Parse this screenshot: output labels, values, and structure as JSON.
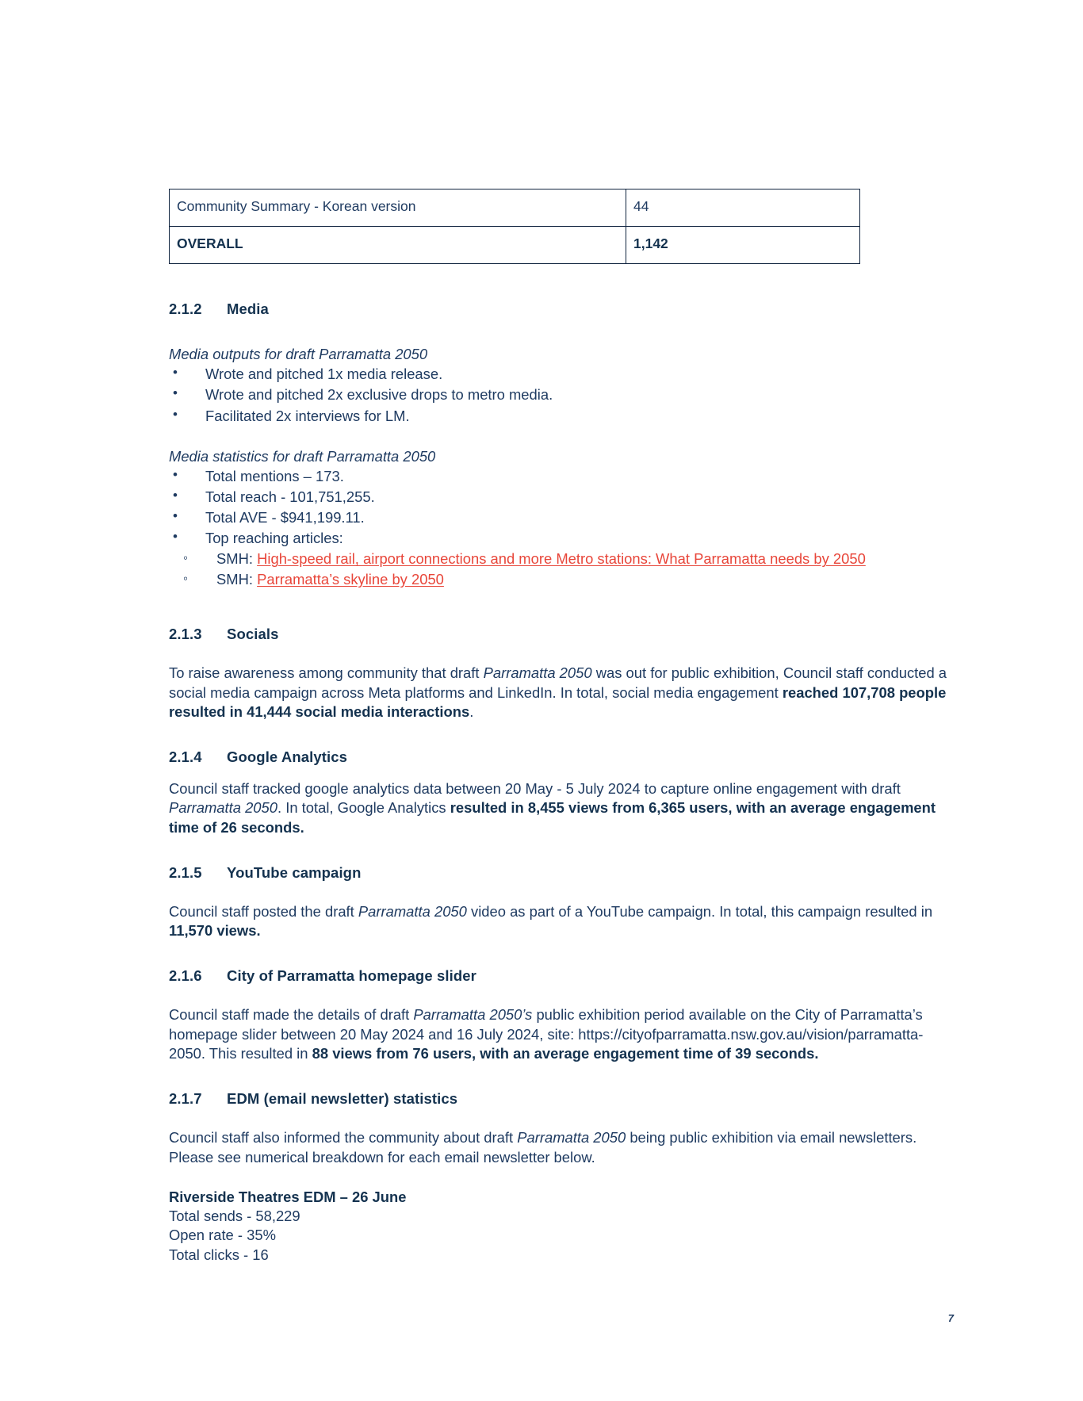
{
  "document": {
    "page_number": "7"
  },
  "table": {
    "rows": [
      {
        "label": "Community Summary - Korean version",
        "value": "44"
      },
      {
        "label": "OVERALL",
        "value": "1,142"
      }
    ]
  },
  "sections": {
    "media": {
      "number": "2.1.2",
      "title": "Media",
      "outputs_heading": "Media outputs for draft Parramatta 2050",
      "outputs": [
        "Wrote and pitched 1x media release.",
        "Wrote and pitched 2x exclusive drops to metro media.",
        "Facilitated 2x interviews for LM."
      ],
      "stats_heading": "Media statistics for draft Parramatta 2050",
      "stats": [
        "Total mentions – 173.",
        "Total reach - 101,751,255.",
        "Total AVE - $941,199.11.",
        "Top reaching articles:"
      ],
      "articles": [
        {
          "source": "SMH:",
          "link_text": "High-speed rail, airport connections and more Metro stations: What Parramatta needs by 2050"
        },
        {
          "source": "SMH:",
          "link_text": "Parramatta’s skyline by 2050"
        }
      ]
    },
    "socials": {
      "number": "2.1.3",
      "title": "Socials",
      "para_1": "To raise awareness among community that draft ",
      "para_italic_1": "Parramatta 2050",
      "para_2": " was out for public exhibition, Council staff conducted a social media campaign across Meta platforms and LinkedIn. In total, social media engagement ",
      "para_bold": "reached 107,708 people resulted in 41,444 social media interactions",
      "para_3": "."
    },
    "google_analytics": {
      "number": "2.1.4",
      "title": "Google Analytics",
      "para_1": "Council staff tracked google analytics data between 20 May - 5 July 2024 to capture online engagement with draft ",
      "para_italic_1": "Parramatta 2050",
      "para_2": ". In total, Google Analytics ",
      "para_bold": "resulted in 8,455 views from 6,365 users, with an average engagement time of 26 seconds."
    },
    "youtube": {
      "number": "2.1.5",
      "title": "YouTube campaign",
      "para_1": "Council staff posted the draft ",
      "para_italic_1": "Parramatta 2050",
      "para_2": " video as part of a YouTube campaign. In total, this campaign resulted in ",
      "para_bold": "11,570 views."
    },
    "homepage_slider": {
      "number": "2.1.6",
      "title": "City of Parramatta homepage slider",
      "para_1": "Council staff made the details of draft ",
      "para_italic_1": "Parramatta 2050’s",
      "para_2": " public exhibition period available on the City of Parramatta’s homepage slider between 20 May 2024 and 16 July 2024, site: https://cityofparramatta.nsw.gov.au/vision/parramatta-2050. This resulted in ",
      "para_bold": "88 views from 76 users, with an average engagement time of 39 seconds."
    },
    "edm": {
      "number": "2.1.7",
      "title": "EDM (email newsletter) statistics",
      "para_1": "Council staff also informed the community about draft ",
      "para_italic_1": "Parramatta 2050",
      "para_2": " being public exhibition via email newsletters. Please see numerical breakdown for each email newsletter below.",
      "newsletter": {
        "title": "Riverside Theatres EDM – 26 June",
        "lines": [
          "Total sends - 58,229",
          "Open rate - 35%",
          "Total clicks - 16"
        ]
      }
    }
  },
  "colors": {
    "text": "#1f3b61",
    "heading": "#14324f",
    "link": "#e8463a",
    "table_border": "#10243f"
  }
}
